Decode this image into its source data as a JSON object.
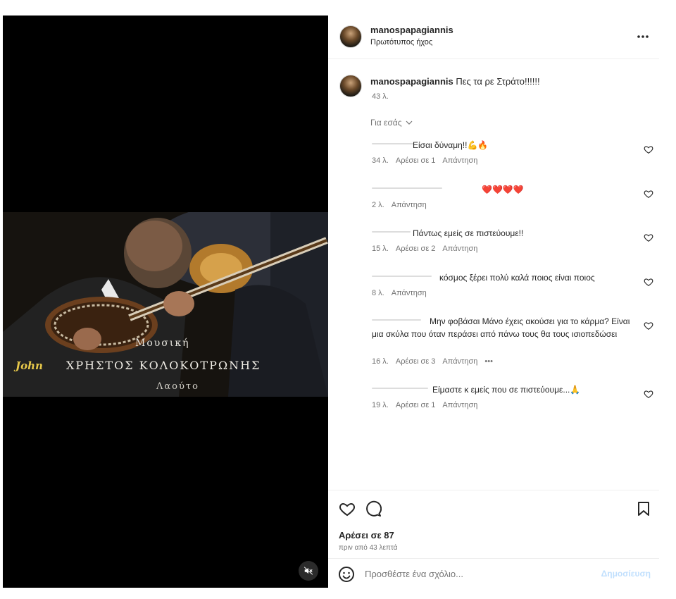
{
  "video": {
    "caption_small": "Μουσική",
    "caption_main": "ΧΡΗΣΤΟΣ ΚΟΛΟΚΟΤΡΩΝΗΣ",
    "caption_sign": "John",
    "caption_sub": "Λαούτο",
    "mute_icon": "muted-speaker-icon"
  },
  "header": {
    "username": "manospapagiannis",
    "audio": "Πρωτότυπος ήχος",
    "more_icon": "more-options-icon"
  },
  "caption": {
    "username": "manospapagiannis",
    "text": "Πες τα ρε Στράτο!!!!!!",
    "time": "43 λ."
  },
  "filter": {
    "label": "Για εσάς"
  },
  "comments": [
    {
      "text": "Είσαι δύναμη!!💪🔥",
      "time": "34 λ.",
      "likes": "Αρέσει σε 1",
      "reply": "Απάντηση"
    },
    {
      "text": "❤️❤️❤️❤️",
      "time": "2 λ.",
      "likes": "",
      "reply": "Απάντηση"
    },
    {
      "text": "Πάντως εμείς σε πιστεύουμε!!",
      "time": "15 λ.",
      "likes": "Αρέσει σε 2",
      "reply": "Απάντηση"
    },
    {
      "text": "κόσμος ξέρει πολύ καλά ποιος είναι ποιος",
      "time": "8 λ.",
      "likes": "",
      "reply": "Απάντηση"
    },
    {
      "text": "Μην φοβάσαι Μάνο έχεις ακούσει για το κάρμα? Είναι μια σκύλα που όταν περάσει από πάνω τους θα τους ισιοπεδώσει",
      "time": "16 λ.",
      "likes": "Αρέσει σε 3",
      "reply": "Απάντηση",
      "more": "•••"
    },
    {
      "text": "Είμαστε κ εμείς που σε πιστεύουμε...🙏",
      "time": "19 λ.",
      "likes": "Αρέσει σε 1",
      "reply": "Απάντηση"
    }
  ],
  "actions": {
    "likes": "Αρέσει σε 87",
    "time_ago": "πριν από 43 λεπτά"
  },
  "composer": {
    "placeholder": "Προσθέστε ένα σχόλιο...",
    "post_label": "Δημοσίευση"
  },
  "colors": {
    "heart_red": "#e0245e",
    "link_blue_disabled": "#c0dffd",
    "meta_gray": "#737373"
  }
}
